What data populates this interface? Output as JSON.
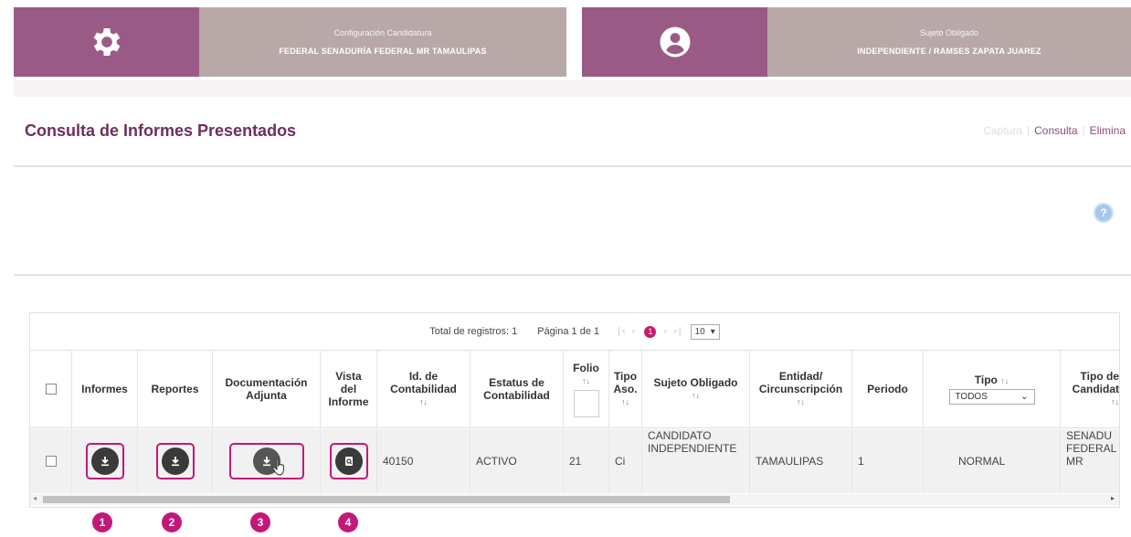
{
  "header_left": {
    "label": "Configuración Candidatura",
    "value": "FEDERAL SENADURÍA FEDERAL MR TAMAULIPAS"
  },
  "header_right": {
    "label": "Sujeto Obligado",
    "value": "INDEPENDIENTE / RAMSES ZAPATA JUAREZ"
  },
  "page": {
    "title": "Consulta de Informes Presentados"
  },
  "breadcrumb": {
    "first": "Captura",
    "sep1": "|",
    "current": "Consulta",
    "sep2": "|",
    "last": "Elimina"
  },
  "help": {
    "label": "?"
  },
  "pager": {
    "total": "Total de registros: 1",
    "page": "Página 1 de 1",
    "prev_arrows": "|‹ ‹",
    "current_page": "1",
    "next_arrows": "› ›|",
    "page_size": "10"
  },
  "columns": {
    "informes": "Informes",
    "reportes": "Reportes",
    "doc1": "Documentación",
    "doc2": "Adjunta",
    "vista1": "Vista",
    "vista2": "del",
    "vista3": "Informe",
    "idc1": "Id. de",
    "idc2": "Contabilidad",
    "est1": "Estatus de",
    "est2": "Contabilidad",
    "folio": "Folio",
    "tipo1": "Tipo",
    "tipo2": "Aso.",
    "sujeto": "Sujeto Obligado",
    "ent1": "Entidad/",
    "ent2": "Circunscripción",
    "periodo": "Periodo",
    "tipo": "Tipo",
    "tipo_filter": "TODOS",
    "tcand1": "Tipo de",
    "tcand2": "Candidat"
  },
  "sort_glyph": "↑↓",
  "rows": [
    {
      "id": "40150",
      "estatus": "ACTIVO",
      "folio": "21",
      "tipo_aso": "Ci",
      "sujeto1": "CANDIDATO",
      "sujeto2": "INDEPENDIENTE",
      "entidad": "TAMAULIPAS",
      "periodo": "1",
      "tipo": "NORMAL",
      "tcand1": "SENADU",
      "tcand2": "FEDERAL",
      "tcand3": "MR"
    }
  ],
  "callouts": [
    "1",
    "2",
    "3",
    "4"
  ],
  "colors": {
    "accent": "#9a5a86",
    "highlight": "#c3187a",
    "title": "#6d2f5e"
  }
}
